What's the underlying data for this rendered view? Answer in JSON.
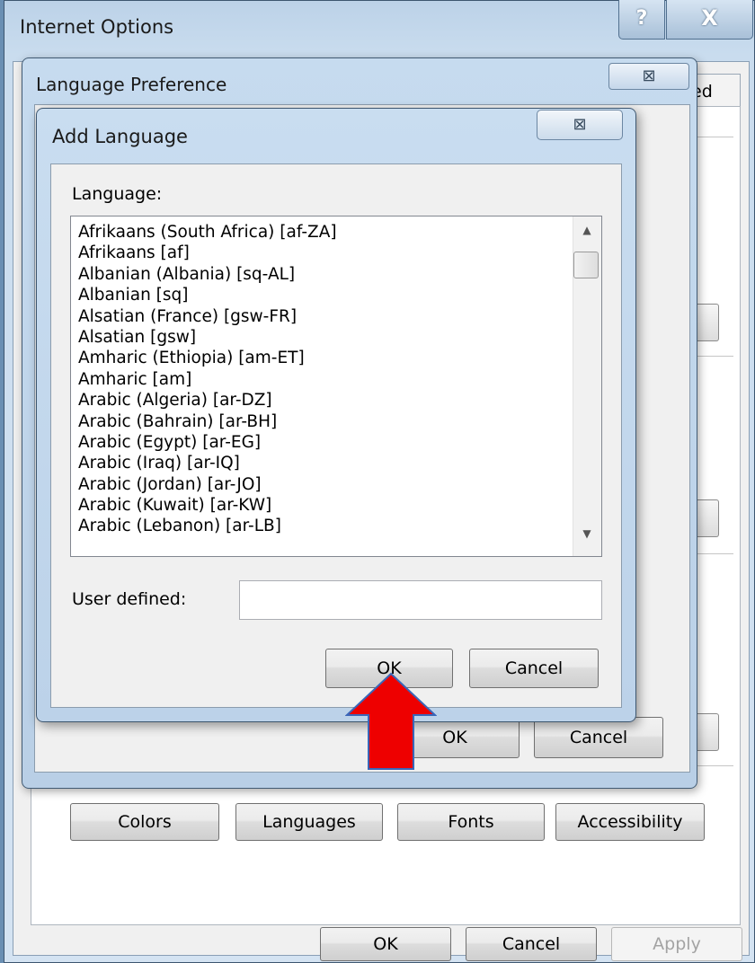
{
  "internet_options": {
    "title": "Internet Options",
    "help_glyph": "?",
    "close_glyph": "X",
    "visible_tab": "ed",
    "buttons": {
      "colors": "Colors",
      "languages": "Languages",
      "fonts": "Fonts",
      "accessibility": "Accessibility"
    },
    "footer": {
      "ok": "OK",
      "cancel": "Cancel",
      "apply": "Apply"
    }
  },
  "language_preference": {
    "title": "Language Preference",
    "close_glyph": "⊠",
    "ok": "OK",
    "cancel": "Cancel"
  },
  "add_language": {
    "title": "Add Language",
    "close_glyph": "⊠",
    "language_label": "Language:",
    "languages": [
      "Afrikaans (South Africa) [af-ZA]",
      "Afrikaans [af]",
      "Albanian (Albania) [sq-AL]",
      "Albanian [sq]",
      "Alsatian (France) [gsw-FR]",
      "Alsatian [gsw]",
      "Amharic (Ethiopia) [am-ET]",
      "Amharic [am]",
      "Arabic (Algeria) [ar-DZ]",
      "Arabic (Bahrain) [ar-BH]",
      "Arabic (Egypt) [ar-EG]",
      "Arabic (Iraq) [ar-IQ]",
      "Arabic (Jordan) [ar-JO]",
      "Arabic (Kuwait) [ar-KW]",
      "Arabic (Lebanon) [ar-LB]"
    ],
    "user_defined_label": "User defined:",
    "user_defined_value": "",
    "ok": "OK",
    "cancel": "Cancel"
  },
  "colors": {
    "arrow": "#ee0000",
    "arrow_outline": "#3a66b8"
  }
}
